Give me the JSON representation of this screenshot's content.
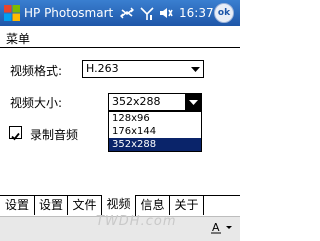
{
  "titlebar": {
    "app_title": "HP Photosmart",
    "clock": "16:37",
    "ok_label": "ok",
    "icons": [
      "windows-start-icon",
      "connectivity-icon",
      "signal-icon",
      "volume-icon"
    ]
  },
  "section": {
    "header": "菜单"
  },
  "form": {
    "video_format": {
      "label": "视频格式:",
      "value": "H.263"
    },
    "video_size": {
      "label": "视频大小:",
      "value": "352x288",
      "options": [
        "128x96",
        "176x144",
        "352x288"
      ],
      "selected_index": 2
    },
    "record_audio": {
      "label": "录制音频",
      "checked": true
    }
  },
  "tabs": [
    {
      "label": "设置",
      "active": false
    },
    {
      "label": "设置",
      "active": false
    },
    {
      "label": "文件",
      "active": false
    },
    {
      "label": "视频",
      "active": true
    },
    {
      "label": "信息",
      "active": false
    },
    {
      "label": "关于",
      "active": false
    }
  ],
  "menubar": {
    "watermark": "TWDH.com",
    "sip_icon": "keyboard-icon"
  },
  "colors": {
    "titlebar": "#1e56a8",
    "selection": "#0a246a"
  }
}
